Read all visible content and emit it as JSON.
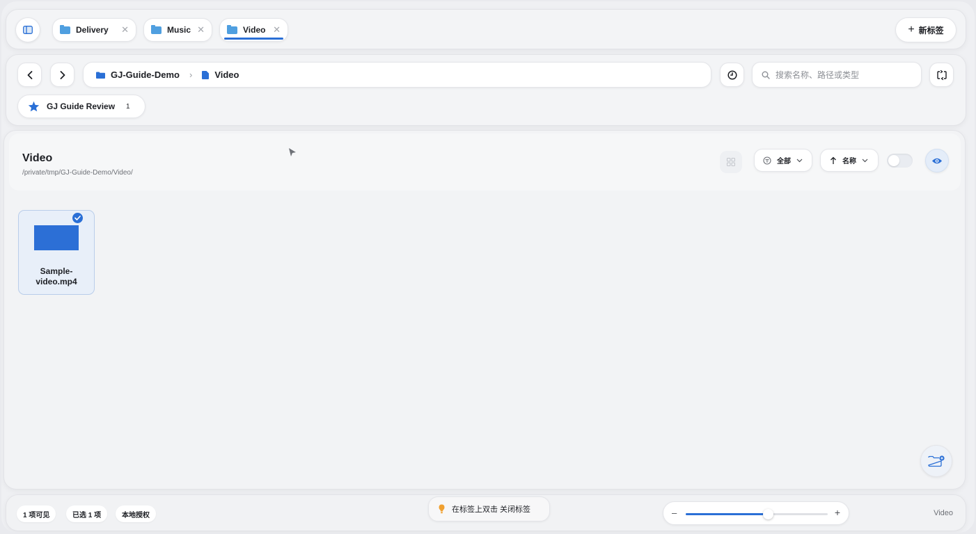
{
  "tabs": [
    {
      "label": "Delivery",
      "active": false
    },
    {
      "label": "Music",
      "active": false
    },
    {
      "label": "Video",
      "active": true
    }
  ],
  "new_tab_label": "新标签",
  "breadcrumb": {
    "root": "GJ-Guide-Demo",
    "current": "Video"
  },
  "search": {
    "placeholder": "搜索名称、路径或类型"
  },
  "favorite": {
    "label": "GJ Guide Review",
    "count": "1"
  },
  "folder_header": {
    "title": "Video",
    "path": "/private/tmp/GJ-Guide-Demo/Video/"
  },
  "toolbar": {
    "filter_label": "全部",
    "sort_label": "名称"
  },
  "files": [
    {
      "name_line1": "Sample-",
      "name_line2": "video.mp4",
      "selected": true
    }
  ],
  "status": {
    "visible": "1 项可见",
    "selected": "已选 1 项",
    "license": "本地授权",
    "tip": "在标签上双击 关闭标签",
    "zoom_value": 0.58,
    "location": "Video"
  },
  "colors": {
    "accent": "#2a6fd6",
    "file_thumb": "#2c6fd6",
    "tip_bulb": "#f0a030"
  }
}
